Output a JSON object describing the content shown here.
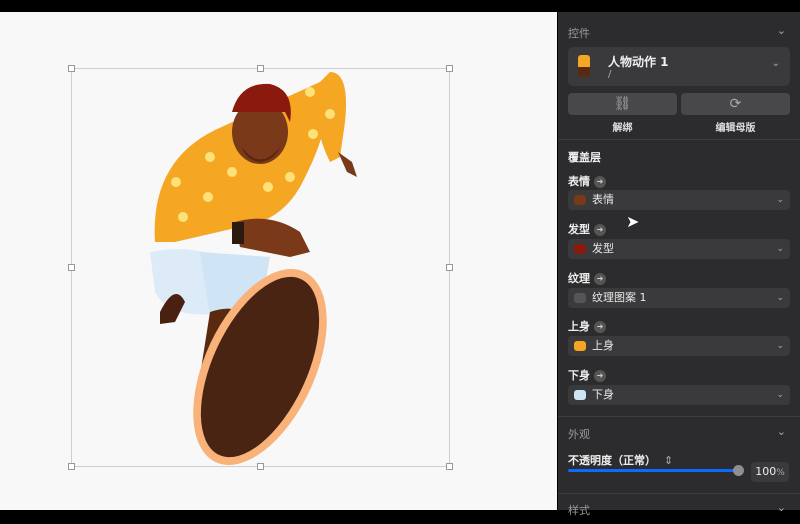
{
  "panel": {
    "controls_title": "控件",
    "component": {
      "name": "人物动作 1",
      "path": "/"
    },
    "detach_label": "解绑",
    "edit_master_label": "编辑母版",
    "overrides_title": "覆盖层",
    "overrides": [
      {
        "label": "表情",
        "value": "表情",
        "color": "#7a3a1a"
      },
      {
        "label": "发型",
        "value": "发型",
        "color": "#8b1a0e"
      },
      {
        "label": "纹理",
        "value": "纹理图案 1",
        "color": "#555555"
      },
      {
        "label": "上身",
        "value": "上身",
        "color": "#f5a623"
      },
      {
        "label": "下身",
        "value": "下身",
        "color": "#cfe4f5"
      }
    ],
    "appearance_title": "外观",
    "opacity_label": "不透明度（正常）",
    "opacity_value": "100",
    "opacity_unit": "%",
    "opacity_fraction": 1.0,
    "style_title": "样式"
  },
  "colors": {
    "accent": "#0a6cff",
    "shirt": "#f5a623",
    "skin": "#7a3a1a"
  }
}
